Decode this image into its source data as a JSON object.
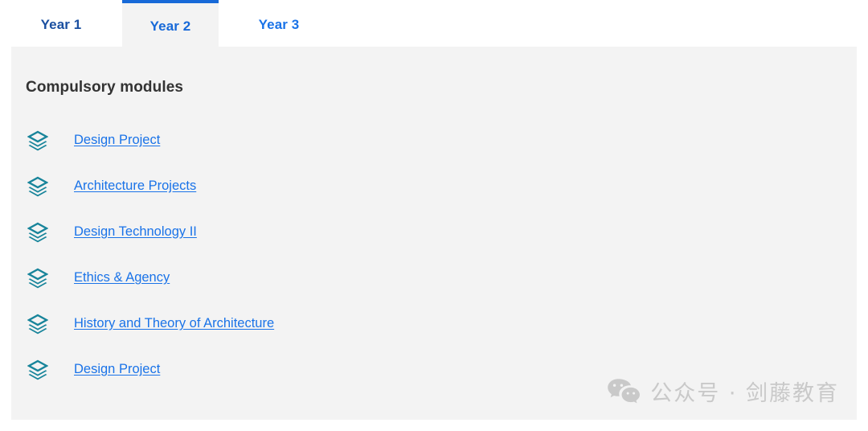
{
  "tabs": [
    {
      "label": "Year 1",
      "active": false,
      "color": "#1a4fa0"
    },
    {
      "label": "Year 2",
      "active": true,
      "color": "#1769d8"
    },
    {
      "label": "Year 3",
      "active": false,
      "color": "#1a73e8"
    }
  ],
  "panel": {
    "heading": "Compulsory modules",
    "background_color": "#f3f3f3",
    "icon_name": "layers-icon",
    "icon_color": "#17849a",
    "link_color": "#1a73e8",
    "modules": [
      {
        "label": "Design Project"
      },
      {
        "label": "Architecture Projects"
      },
      {
        "label": "Design Technology II"
      },
      {
        "label": "Ethics & Agency"
      },
      {
        "label": "History and Theory of Architecture"
      },
      {
        "label": "Design Project"
      }
    ]
  },
  "watermark": {
    "icon_name": "wechat-icon",
    "text": "公众号 · 剑藤教育",
    "color": "#c9c9c9"
  }
}
